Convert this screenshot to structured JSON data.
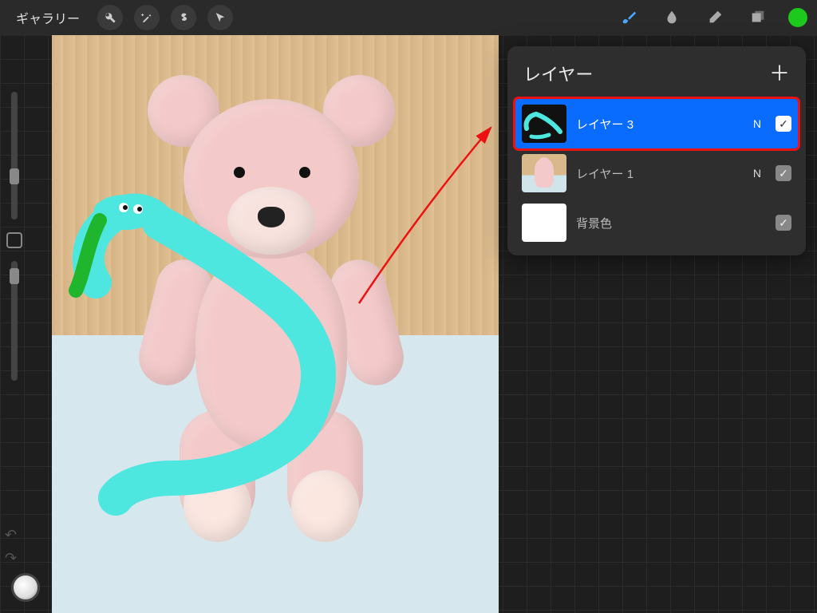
{
  "topbar": {
    "gallery_label": "ギャラリー",
    "tools_left": [
      "adjustments",
      "magic",
      "selection",
      "transform"
    ],
    "tools_right": {
      "brush_active": true,
      "swatch_color": "#1ec91e"
    }
  },
  "sidebar": {
    "brush_size_pos_pct": 60,
    "opacity_pos_pct": 8
  },
  "layers_panel": {
    "title": "レイヤー",
    "items": [
      {
        "name": "レイヤー 3",
        "blend": "N",
        "visible": true,
        "selected": true,
        "highlighted": true,
        "thumb": "snake"
      },
      {
        "name": "レイヤー 1",
        "blend": "N",
        "visible": true,
        "selected": false,
        "thumb": "bear"
      },
      {
        "name": "背景色",
        "blend": "",
        "visible": true,
        "selected": false,
        "thumb": "white"
      }
    ]
  },
  "canvas": {
    "artwork": "pink teddy bear on bed with cyan snake drawing",
    "snake_color": "#4ee7df",
    "tongue_color": "#1fb62e"
  },
  "annotation": {
    "arrow_color": "#e11"
  }
}
